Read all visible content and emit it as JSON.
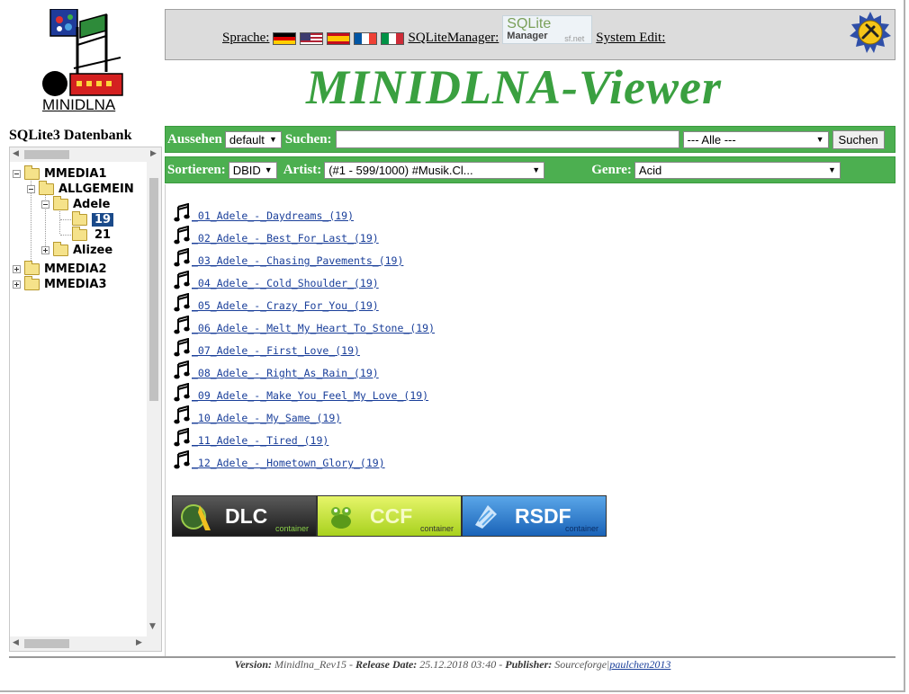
{
  "header": {
    "logo_text": "MINIDLNA",
    "language_label": "Sprache:",
    "languages": [
      "de",
      "us",
      "es",
      "fr",
      "it"
    ],
    "sqlitemanager_label": "SQLiteManager:",
    "sqlitemanager_logo": {
      "line1": "SQLite",
      "line2": "Manager",
      "line3": "sf.net"
    },
    "system_edit_label": "System Edit:",
    "title": "MINIDLNA-Viewer"
  },
  "sidebar": {
    "title": "SQLite3 Datenbank",
    "tree": [
      {
        "label": "MMEDIA1",
        "level": 0,
        "expanded": true
      },
      {
        "label": "ALLGEMEIN",
        "level": 1,
        "expanded": true
      },
      {
        "label": "Adele",
        "level": 2,
        "expanded": true
      },
      {
        "label": "19",
        "level": 3,
        "selected": true
      },
      {
        "label": "21",
        "level": 3
      },
      {
        "label": "Alizee",
        "level": 2,
        "expanded": false
      },
      {
        "label": "MMEDIA2",
        "level": 0,
        "expanded": false
      },
      {
        "label": "MMEDIA3",
        "level": 0,
        "expanded": false
      }
    ]
  },
  "toolbar1": {
    "appearance_label": "Aussehen",
    "appearance_value": "default",
    "search_label": "Suchen:",
    "search_value": "",
    "category_value": "--- Alle ---",
    "search_button": "Suchen"
  },
  "toolbar2": {
    "sort_label": "Sortieren:",
    "sort_value": "DBID",
    "artist_label": "Artist:",
    "artist_value": "(#1 - 599/1000) #Musik.Cl...",
    "genre_label": "Genre:",
    "genre_value": "Acid"
  },
  "songs": [
    "_01_Adele_-_Daydreams_(19)",
    "_02_Adele_-_Best_For_Last_(19)",
    "_03_Adele_-_Chasing_Pavements_(19)",
    "_04_Adele_-_Cold_Shoulder_(19)",
    "_05_Adele_-_Crazy_For_You_(19)",
    "_06_Adele_-_Melt_My_Heart_To_Stone_(19)",
    "_07_Adele_-_First_Love_(19)",
    "_08_Adele_-_Right_As_Rain_(19)",
    "_09_Adele_-_Make_You_Feel_My_Love_(19)",
    "_10_Adele_-_My_Same_(19)",
    "_11_Adele_-_Tired_(19)",
    "_12_Adele_-_Hometown_Glory_(19)"
  ],
  "containers": [
    {
      "name": "DLC",
      "sub": "container",
      "icon": "dlc-logo-icon"
    },
    {
      "name": "CCF",
      "sub": "container",
      "icon": "ccf-frog-icon"
    },
    {
      "name": "RSDF",
      "sub": "container",
      "icon": "rsdf-logo-icon"
    }
  ],
  "footer": {
    "version_label": "Version:",
    "version_value": "Minidlna_Rev15",
    "release_label": "Release Date:",
    "release_value": "25.12.2018 03:40",
    "publisher_label": "Publisher:",
    "publisher_value": "Sourceforge|",
    "publisher_link": "paulchen2013"
  },
  "colors": {
    "accent_green": "#4caf50",
    "title_green": "#3aa040",
    "link_blue": "#1a3f9a",
    "selection_blue": "#1a4a8a"
  }
}
